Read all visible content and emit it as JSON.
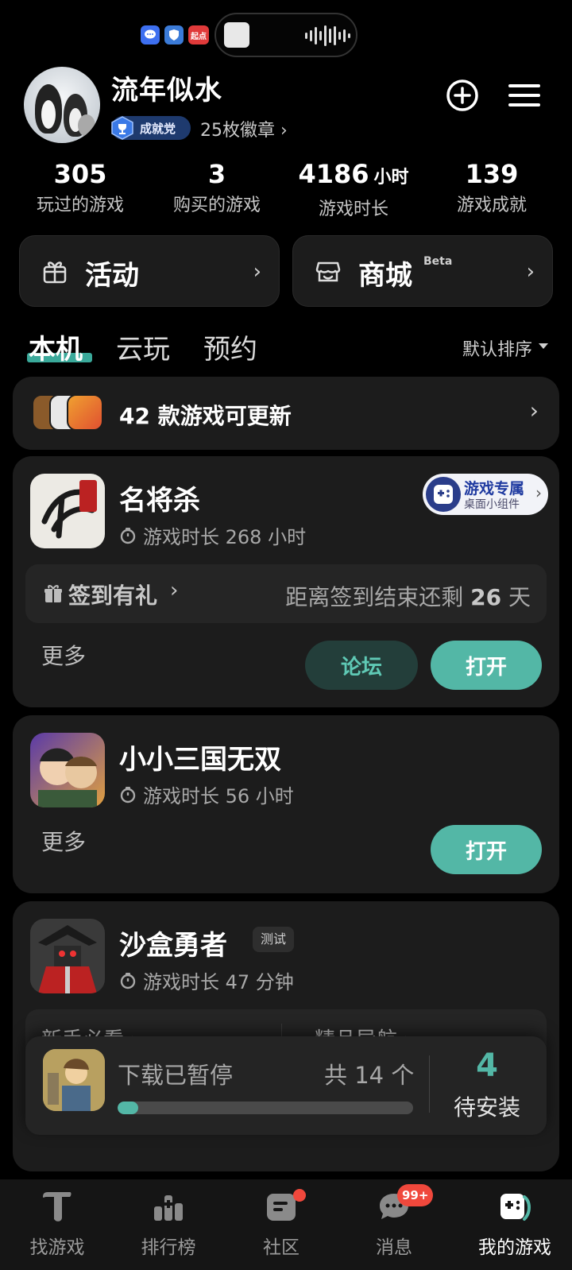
{
  "status_bar": {
    "qidian_label": "起点"
  },
  "profile": {
    "username": "流年似水",
    "badge_title": "成就党",
    "badge_count": "25枚徽章 ›"
  },
  "stats": [
    {
      "value": "305",
      "unit": "",
      "label": "玩过的游戏"
    },
    {
      "value": "3",
      "unit": "",
      "label": "购买的游戏"
    },
    {
      "value": "4186",
      "unit": "小时",
      "label": "游戏时长"
    },
    {
      "value": "139",
      "unit": "",
      "label": "游戏成就"
    }
  ],
  "quick_actions": {
    "activity": {
      "label": "活动",
      "icon": "gift-icon"
    },
    "store": {
      "label": "商城",
      "tag": "Beta",
      "icon": "store-icon"
    }
  },
  "tabs": [
    {
      "label": "本机",
      "active": true
    },
    {
      "label": "云玩",
      "active": false
    },
    {
      "label": "预约",
      "active": false
    }
  ],
  "sort_label": "默认排序",
  "update_banner": {
    "text": "42 款游戏可更新",
    "icon_colors": [
      "#8a5a2a",
      "#e8e8e8",
      "#f0a030"
    ]
  },
  "games": [
    {
      "title": "名将杀",
      "playtime": "游戏时长 268 小时",
      "widget": {
        "line1": "游戏专属",
        "line2": "桌面小组件"
      },
      "checkin": {
        "label": "签到有礼",
        "remaining_prefix": "距离签到结束还剩",
        "remaining_days": "26",
        "remaining_suffix": "天"
      },
      "more_label": "更多",
      "forum_label": "论坛",
      "open_label": "打开"
    },
    {
      "title": "小小三国无双",
      "playtime": "游戏时长 56 小时",
      "more_label": "更多",
      "open_label": "打开"
    },
    {
      "title": "沙盒勇者",
      "tag": "测试",
      "playtime": "游戏时长 47 分钟",
      "links": [
        "新手必看 ›",
        "精品导航 ›"
      ]
    }
  ],
  "download": {
    "status": "下载已暂停",
    "total": "共 14 个",
    "progress": 0.07,
    "pending_count": "4",
    "pending_label": "待安装"
  },
  "bottom_nav": [
    {
      "label": "找游戏",
      "icon": "find-games-icon",
      "active": false
    },
    {
      "label": "排行榜",
      "icon": "ranking-icon",
      "active": false
    },
    {
      "label": "社区",
      "icon": "community-icon",
      "active": false
    },
    {
      "label": "消息",
      "icon": "message-icon",
      "active": false,
      "badge": "99+"
    },
    {
      "label": "我的游戏",
      "icon": "my-games-icon",
      "active": true
    }
  ],
  "colors": {
    "accent": "#53b7a6",
    "card_bg": "#1c1c1c",
    "badge_red": "#f0483c"
  }
}
